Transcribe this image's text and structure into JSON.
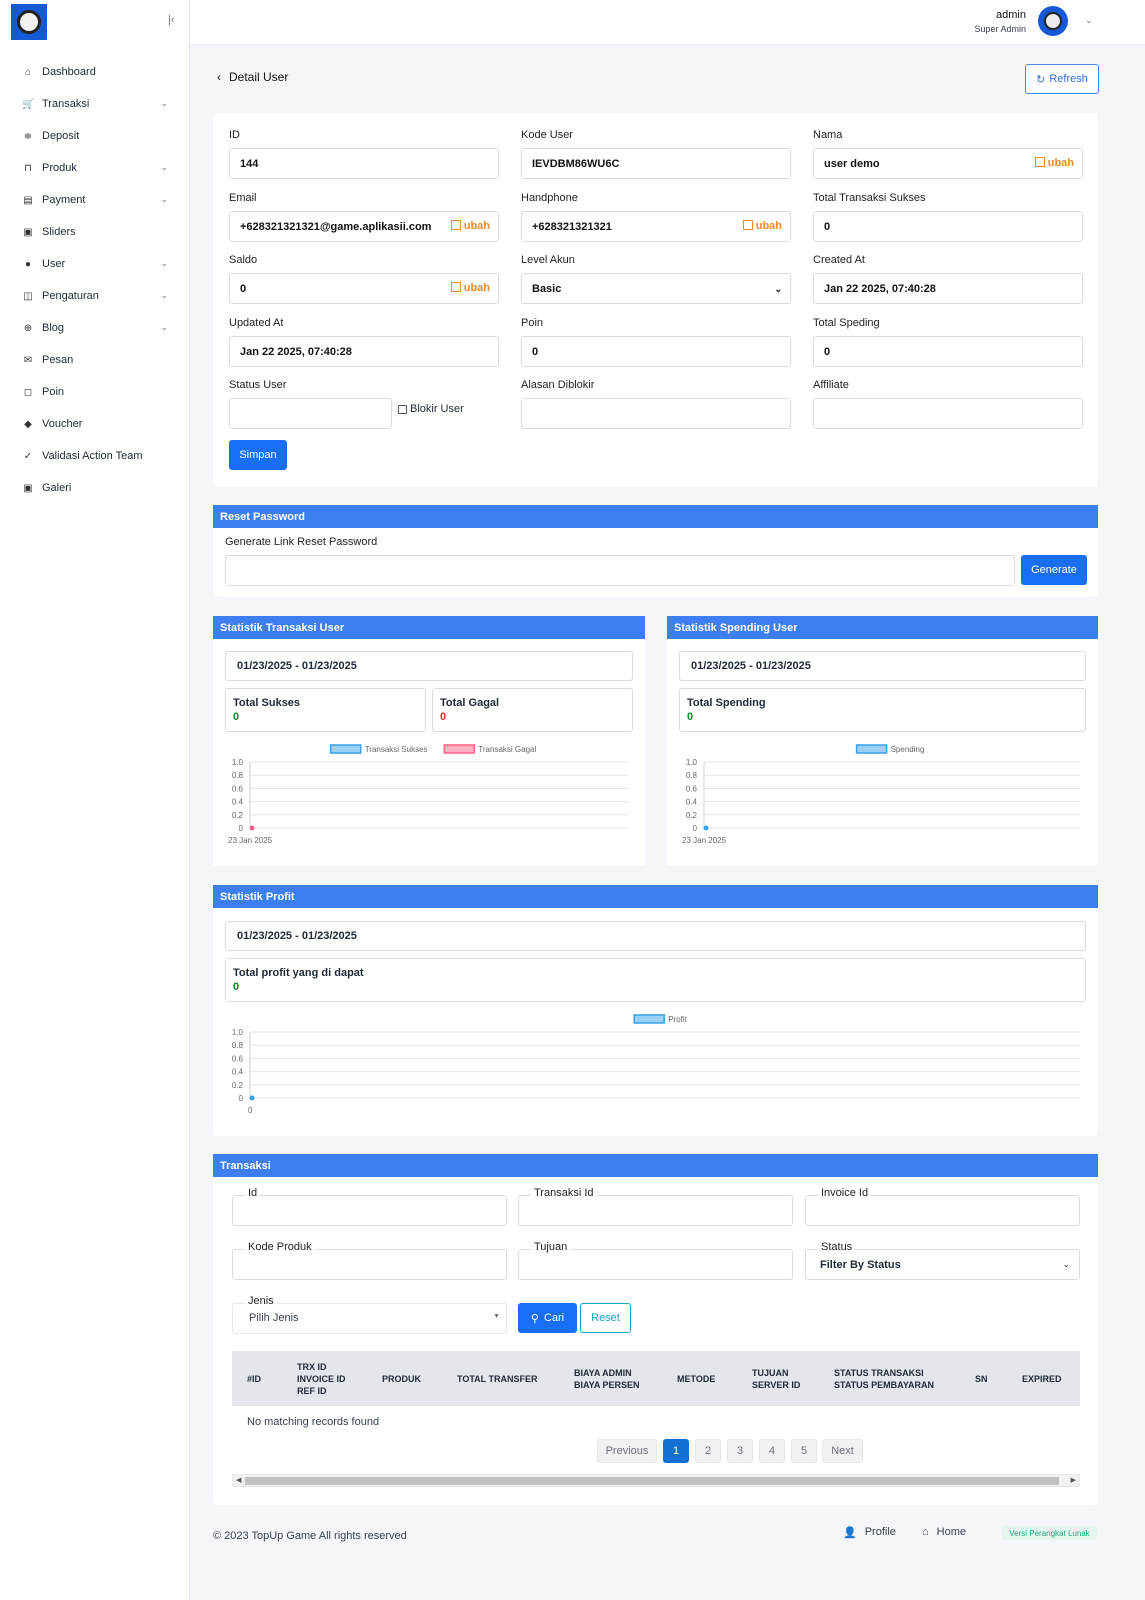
{
  "sidebar": {
    "collapse_icon": "collapse-icon",
    "items": [
      {
        "label": "Dashboard",
        "icon": "home-icon",
        "has_children": false
      },
      {
        "label": "Transaksi",
        "icon": "cart-icon",
        "has_children": true
      },
      {
        "label": "Deposit",
        "icon": "coins-icon",
        "has_children": false
      },
      {
        "label": "Produk",
        "icon": "store-icon",
        "has_children": true
      },
      {
        "label": "Payment",
        "icon": "wallet-icon",
        "has_children": true
      },
      {
        "label": "Sliders",
        "icon": "image-icon",
        "has_children": false
      },
      {
        "label": "User",
        "icon": "user-icon",
        "has_children": true
      },
      {
        "label": "Pengaturan",
        "icon": "settings-icon",
        "has_children": true
      },
      {
        "label": "Blog",
        "icon": "globe-icon",
        "has_children": true
      },
      {
        "label": "Pesan",
        "icon": "mail-icon",
        "has_children": false
      },
      {
        "label": "Poin",
        "icon": "badge-icon",
        "has_children": false
      },
      {
        "label": "Voucher",
        "icon": "ticket-icon",
        "has_children": false
      },
      {
        "label": "Validasi Action Team",
        "icon": "check-icon",
        "has_children": false
      },
      {
        "label": "Galeri",
        "icon": "gallery-icon",
        "has_children": false
      }
    ]
  },
  "header": {
    "user_name": "admin",
    "user_role": "Super Admin"
  },
  "page": {
    "back_icon": "‹",
    "title": "Detail User",
    "refresh_label": "Refresh",
    "refresh_icon": "↻"
  },
  "user_form": {
    "id": {
      "label": "ID",
      "value": "144"
    },
    "kode_user": {
      "label": "Kode User",
      "value": "IEVDBM86WU6C"
    },
    "nama": {
      "label": "Nama",
      "value": "user demo",
      "edit": "ubah"
    },
    "email": {
      "label": "Email",
      "value": "+628321321321@game.aplikasii.com",
      "edit": "ubah"
    },
    "handphone": {
      "label": "Handphone",
      "value": "+628321321321",
      "edit": "ubah"
    },
    "total_transaksi": {
      "label": "Total Transaksi Sukses",
      "value": "0"
    },
    "saldo": {
      "label": "Saldo",
      "value": "0",
      "edit": "ubah"
    },
    "level_akun": {
      "label": "Level Akun",
      "value": "Basic"
    },
    "created_at": {
      "label": "Created At",
      "value": "Jan 22 2025, 07:40:28"
    },
    "updated_at": {
      "label": "Updated At",
      "value": "Jan 22 2025, 07:40:28"
    },
    "poin": {
      "label": "Poin",
      "value": "0"
    },
    "total_speding": {
      "label": "Total Speding",
      "value": "0"
    },
    "status_user": {
      "label": "Status User",
      "value": "",
      "blokir_label": "Blokir User",
      "blokir_checked": false
    },
    "alasan": {
      "label": "Alasan Diblokir",
      "value": ""
    },
    "affiliate": {
      "label": "Affiliate",
      "value": ""
    },
    "save_label": "Simpan"
  },
  "reset_password": {
    "header": "Reset Password",
    "label": "Generate Link Reset Password",
    "value": "",
    "button": "Generate"
  },
  "stat_transaksi": {
    "header": "Statistik Transaksi User",
    "date_range": "01/23/2025 - 01/23/2025",
    "sukses_label": "Total Sukses",
    "sukses_value": "0",
    "gagal_label": "Total Gagal",
    "gagal_value": "0"
  },
  "stat_spending": {
    "header": "Statistik Spending User",
    "date_range": "01/23/2025 - 01/23/2025",
    "total_label": "Total Spending",
    "total_value": "0"
  },
  "stat_profit": {
    "header": "Statistik Profit",
    "date_range": "01/23/2025 - 01/23/2025",
    "total_label": "Total profit yang di dapat",
    "total_value": "0"
  },
  "chart_data": [
    {
      "type": "line",
      "x": [
        "23 Jan 2025"
      ],
      "series": [
        {
          "name": "Transaksi Sukses",
          "values": [
            0
          ],
          "color": "#36a2eb"
        },
        {
          "name": "Transaksi Gagal",
          "values": [
            0
          ],
          "color": "#ff6384"
        }
      ],
      "yticks": [
        "1.0",
        "0.8",
        "0.6",
        "0.4",
        "0.2",
        "0"
      ],
      "ylim": [
        0,
        1
      ],
      "legend": "top",
      "grid": true
    },
    {
      "type": "line",
      "x": [
        "23 Jan 2025"
      ],
      "series": [
        {
          "name": "Spending",
          "values": [
            0
          ],
          "color": "#36a2eb"
        }
      ],
      "yticks": [
        "1.0",
        "0.8",
        "0.6",
        "0.4",
        "0.2",
        "0"
      ],
      "ylim": [
        0,
        1
      ],
      "legend": "top",
      "grid": true
    },
    {
      "type": "line",
      "x": [
        "0"
      ],
      "series": [
        {
          "name": "Profit",
          "values": [
            0
          ],
          "color": "#36a2eb"
        }
      ],
      "yticks": [
        "1.0",
        "0.8",
        "0.6",
        "0.4",
        "0.2",
        "0"
      ],
      "ylim": [
        0,
        1
      ],
      "legend": "top",
      "grid": true
    }
  ],
  "transaksi": {
    "header": "Transaksi",
    "filters": {
      "id": "Id",
      "transaksi_id": "Transaksi Id",
      "invoice_id": "Invoice Id",
      "kode_produk": "Kode Produk",
      "tujuan": "Tujuan",
      "status_label": "Status",
      "status_value": "Filter By Status",
      "jenis_label": "Jenis",
      "jenis_value": "Pilih Jenis"
    },
    "cari_label": "Cari",
    "reset_label": "Reset",
    "columns": [
      "#ID",
      "TRX ID\nINVOICE ID\nREF ID",
      "PRODUK",
      "TOTAL TRANSFER",
      "BIAYA ADMIN\nBIAYA PERSEN",
      "METODE",
      "TUJUAN\nSERVER ID",
      "STATUS TRANSAKSI\nSTATUS PEMBAYARAN",
      "SN",
      "EXPIRED"
    ],
    "empty_text": "No matching records found",
    "pagination": {
      "previous": "Previous",
      "pages": [
        "1",
        "2",
        "3",
        "4",
        "5"
      ],
      "active": "1",
      "next": "Next"
    }
  },
  "footer": {
    "copyright": "© 2023 TopUp Game All rights reserved",
    "profile": "Profile",
    "home": "Home",
    "version": "Versi Perangkat Lunak"
  }
}
